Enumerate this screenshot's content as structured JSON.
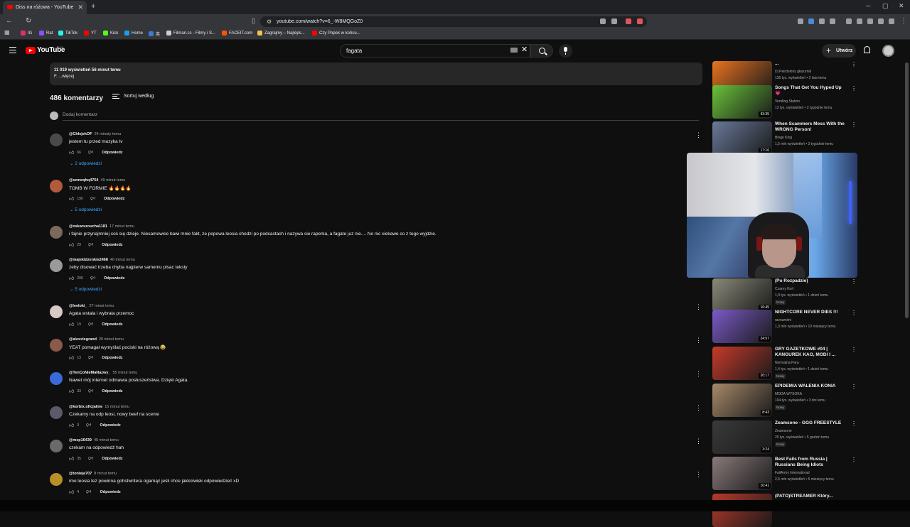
{
  "browser": {
    "tab_title": "Diss na różowa - YouTube",
    "url": "youtube.com/watch?v=6_-W8MQGoZ0",
    "bookmarks": [
      {
        "label": "IG",
        "color": "#e1306c"
      },
      {
        "label": "Rat",
        "color": "#8a4fff"
      },
      {
        "label": "TikTok",
        "color": "#25f4ee"
      },
      {
        "label": "YT",
        "color": "#ff0000"
      },
      {
        "label": "Kick",
        "color": "#53fc18"
      },
      {
        "label": "Home",
        "color": "#1d9bf0"
      },
      {
        "label": "英",
        "color": "#3c7bd4"
      },
      {
        "label": "Filman.cc - Filmy i S...",
        "color": "#cccccc"
      },
      {
        "label": "FACEIT.com",
        "color": "#ff5500"
      },
      {
        "label": "Zagrajmy – Najleps...",
        "color": "#f2c14e"
      },
      {
        "label": "Czy Popek w końcu...",
        "color": "#ff0000"
      }
    ]
  },
  "youtube": {
    "logo_text": "YouTube",
    "country": "PL",
    "search_value": "fagata",
    "create_label": "Utwórz"
  },
  "description": {
    "views_line": "11 019 wyświetleń  56 minut temu",
    "more_line": "F.  ...więcej"
  },
  "comments_header": {
    "count_label": "486 komentarzy",
    "sort_label": "Sortuj według",
    "add_placeholder": "Dodaj komentarz"
  },
  "comments": [
    {
      "handle": "@ChlejekOF",
      "time": "24 minuty temu",
      "text": "jestem tu przed muzyka tv",
      "likes": "66",
      "reply_label": "Odpowiedz",
      "replies": "2 odpowiedzi",
      "avatar_color": "#4a4a4a"
    },
    {
      "handle": "@szmeqhq4754",
      "time": "49 minut temu",
      "text": "TOMB W FORMIE 🔥🔥🔥🔥",
      "likes": "190",
      "reply_label": "Odpowiedz",
      "replies": "5 odpowiedzi",
      "avatar_color": "#b45a3c"
    },
    {
      "handle": "@oskarszoucha1181",
      "time": "17 minut temu",
      "text": "i fajnie przynajmniej coś się dzieje. Niesamowice bawi mnie fakt, że popowa leosia chodzi po podcastach i nazywa sie raperka, a fagate juz nie.... No nic ciekawe co z tego wyjdzie.",
      "likes": "29",
      "reply_label": "Odpowiedz",
      "replies": "",
      "avatar_color": "#7a6a5a"
    },
    {
      "handle": "@majekldzenkis2468",
      "time": "40 minut temu",
      "text": "żeby disować trzeba chyba najpierw samemu pisac teksty",
      "likes": "206",
      "reply_label": "Odpowiedz",
      "replies": "5 odpowiedzi",
      "avatar_color": "#9a9a9a"
    },
    {
      "handle": "@leeloki_",
      "time": "27 minut temu",
      "text": "Agata wstała i wybrała przemoc",
      "likes": "19",
      "reply_label": "Odpowiedz",
      "replies": "",
      "avatar_color": "#d8c8c8"
    },
    {
      "handle": "@alexxisgrand",
      "time": "20 minut temu",
      "text": "YEAT pomagał wymyślać pociski na różową 😂",
      "likes": "13",
      "reply_label": "Odpowiedz",
      "replies": "",
      "avatar_color": "#8a5a4a"
    },
    {
      "handle": "@TenCoNieMaNazwy_",
      "time": "55 minut temu",
      "text": "Nawet mój internet odmawia posłuszeństwa. Dzięki Agata.",
      "likes": "33",
      "reply_label": "Odpowiedz",
      "replies": "",
      "avatar_color": "#3a6ad8"
    },
    {
      "handle": "@korbix.oficjalnie",
      "time": "15 minut temu",
      "text": "Czekamy na odp leosi, nowy beef na scenie",
      "likes": "3",
      "reply_label": "Odpowiedz",
      "replies": "",
      "avatar_color": "#5a5a6a"
    },
    {
      "handle": "@msp16439",
      "time": "40 minut temu",
      "text": "czekam na odpowiedź hah",
      "likes": "35",
      "reply_label": "Odpowiedz",
      "replies": "",
      "avatar_color": "#6a6a6a"
    },
    {
      "handle": "@tonieja707",
      "time": "8 minut temu",
      "text": "imo leosia też powinna gohstwritera ogarnąć jeśli chce jakkolwiek odpowiedzieć xD",
      "likes": "4",
      "reply_label": "Odpowiedz",
      "replies": "",
      "avatar_color": "#b8902a"
    }
  ],
  "recommendations": [
    {
      "title": "...",
      "channel": "Dj Peirdolony głazurnik",
      "meta": "135 tys. wyświetleń • 2 lata temu",
      "duration": "25:24",
      "badge": "",
      "thumb": "#e8731f"
    },
    {
      "title": "Songs That Get You Hyped Up 💗",
      "channel": "Vending Station",
      "meta": "13 tys. wyświetleń • 2 tygodnie temu",
      "duration": "43:35",
      "badge": "",
      "thumb": "#6ac43a"
    },
    {
      "title": "When Scammers Mess With the WRONG Person!",
      "channel": "Binge King",
      "meta": "1,5 mln wyświetleń • 3 tygodnie temu",
      "duration": "17:16",
      "badge": "",
      "thumb": "#6a7a9a"
    },
    {
      "title": "(Po Rozpadzie)",
      "channel": "Czarny Koń",
      "meta": "1,9 tys. wyświetleń • 1 dzień temu",
      "duration": "16:45",
      "badge": "Nowy",
      "thumb": "#8a8a7a"
    },
    {
      "title": "NIGHTCORE NEVER DIES !!!",
      "channel": "ravnamimi",
      "meta": "1,3 mln wyświetleń • 10 miesięcy temu",
      "duration": "24:57",
      "badge": "",
      "thumb": "#7a5ac8"
    },
    {
      "title": "GRY GAZETKOWE #04 | KANGUREK KAO, MODI I ...",
      "channel": "Normalna Para",
      "meta": "1,4 tys. wyświetleń • 1 dzień temu",
      "duration": "20:17",
      "badge": "Nowy",
      "thumb": "#c83a2a"
    },
    {
      "title": "EPIDEMIA WALENIA KONIA",
      "channel": "MODA WYSOKA",
      "meta": "104 tys. wyświetleń • 3 dni temu",
      "duration": "8:43",
      "badge": "Nowy",
      "thumb": "#a88a6a"
    },
    {
      "title": "Zeamsone - GGG FREESTYLE",
      "channel": "Zeamsone",
      "meta": "20 tys. wyświetleń • 5 godzin temu",
      "duration": "3:24",
      "badge": "Nowy",
      "thumb": "#3a3a3a"
    },
    {
      "title": "Best Fails from Russia | Russians Being Idiots",
      "channel": "FailArmy International",
      "meta": "2,6 mln wyświetleń • 5 miesięcy temu",
      "duration": "10:41",
      "badge": "",
      "thumb": "#8a7a7a"
    },
    {
      "title": "(PATO)STREAMER Który...",
      "channel": "",
      "meta": "",
      "duration": "",
      "badge": "",
      "thumb": "#b83a2a"
    }
  ]
}
